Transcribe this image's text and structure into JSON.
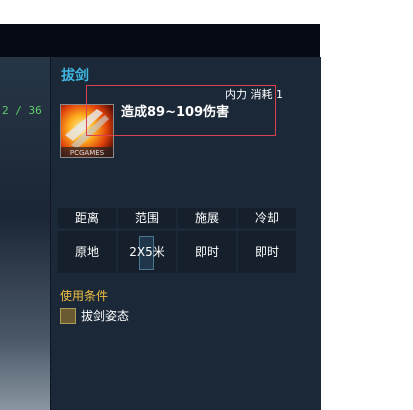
{
  "left_panel": {
    "counter": "2 / 36"
  },
  "tooltip": {
    "skill_name": "拔剑",
    "cost": "内力 消耗 1",
    "effect": "造成89~109伤害",
    "icon_name": "sword-slash-skill-icon",
    "stats": {
      "headers": [
        "距离",
        "范围",
        "施展",
        "冷却"
      ],
      "values": [
        "原地",
        "2X5米",
        "即时",
        "即时"
      ]
    },
    "conditions": {
      "label": "使用条件",
      "items": [
        "拔剑姿态"
      ]
    }
  },
  "colors": {
    "skill_name": "#3fb6e0",
    "condition_label": "#f0c040",
    "highlight_border": "#d9434f",
    "counter": "#5fd06a"
  }
}
